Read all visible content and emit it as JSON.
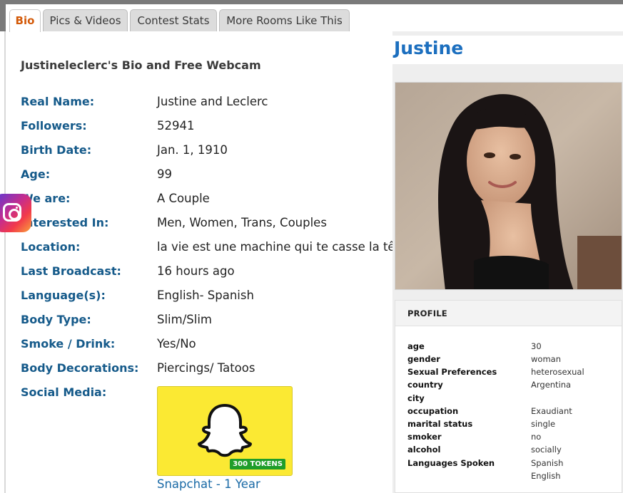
{
  "tabs": [
    {
      "label": "Bio",
      "active": true
    },
    {
      "label": "Pics & Videos",
      "active": false
    },
    {
      "label": "Contest Stats",
      "active": false
    },
    {
      "label": "More Rooms Like This",
      "active": false
    }
  ],
  "bio": {
    "title": "Justineleclerc's Bio and Free Webcam",
    "fields": [
      {
        "label": "Real Name:",
        "value": "Justine and Leclerc"
      },
      {
        "label": "Followers:",
        "value": "52941"
      },
      {
        "label": "Birth Date:",
        "value": "Jan. 1, 1910"
      },
      {
        "label": "Age:",
        "value": "99"
      },
      {
        "label": "We are:",
        "value": "A Couple"
      },
      {
        "label": "Interested In:",
        "value": "Men, Women, Trans, Couples"
      },
      {
        "label": "Location:",
        "value": "la vie est une machine qui te casse la tête"
      },
      {
        "label": "Last Broadcast:",
        "value": "16 hours ago"
      },
      {
        "label": "Language(s):",
        "value": "English- Spanish"
      },
      {
        "label": "Body Type:",
        "value": "Slim/Slim"
      },
      {
        "label": "Smoke / Drink:",
        "value": "Yes/No"
      },
      {
        "label": "Body Decorations:",
        "value": "Piercings/ Tatoos"
      },
      {
        "label": "Social Media:",
        "value": ""
      }
    ],
    "social": {
      "icon": "snapchat-ghost-icon",
      "tokens": "300 TOKENS",
      "link": "Snapchat - 1 Year"
    }
  },
  "floating_badge": {
    "icon": "instagram-icon"
  },
  "right": {
    "name": "Justine",
    "profile": {
      "title": "PROFILE",
      "rows": [
        {
          "key": "age",
          "value": "30"
        },
        {
          "key": "gender",
          "value": "woman"
        },
        {
          "key": "Sexual Preferences",
          "value": "heterosexual"
        },
        {
          "key": "country",
          "value": "Argentina"
        },
        {
          "key": "city",
          "value": ""
        },
        {
          "key": "occupation",
          "value": "Exaudiant"
        },
        {
          "key": "marital status",
          "value": "single"
        },
        {
          "key": "smoker",
          "value": "no"
        },
        {
          "key": "alcohol",
          "value": "socially"
        },
        {
          "key": "Languages Spoken",
          "value": "Spanish"
        },
        {
          "key": "",
          "value": "English"
        }
      ]
    }
  },
  "colors": {
    "active_tab": "#d35a09",
    "label_blue": "#155a8a",
    "name_blue": "#1c6fbf",
    "link_blue": "#1a6aa6",
    "snap_yellow": "#fbe933",
    "token_green": "#1f9d2a"
  }
}
